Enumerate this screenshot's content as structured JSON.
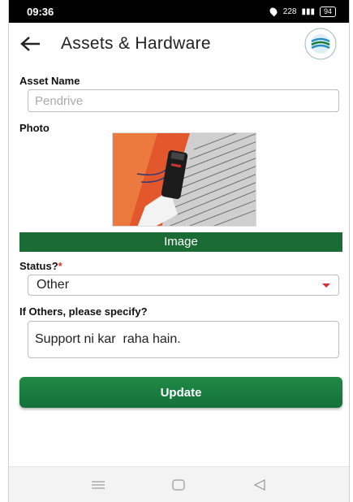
{
  "status_bar": {
    "time": "09:36",
    "indicators": "   228       ",
    "battery": "94"
  },
  "app_bar": {
    "back_icon": "arrow-left-icon",
    "title": "Assets & Hardware",
    "logo_icon": "organization-logo"
  },
  "form": {
    "asset_name_label": "Asset Name",
    "asset_name_placeholder": "Pendrive",
    "asset_name_value": "",
    "photo_label": "Photo",
    "image_button": "Image",
    "status_label": "Status?",
    "status_required_mark": "*",
    "status_value": "Other",
    "specify_label": "If Others, please specify?",
    "specify_value": "Support ni kar  raha hain.",
    "update_button": "Update"
  },
  "colors": {
    "primary_green": "#1b6b34",
    "required_red": "#d9302c"
  },
  "nav_bar": {
    "items": [
      "menu-icon",
      "home-icon",
      "back-icon"
    ]
  }
}
